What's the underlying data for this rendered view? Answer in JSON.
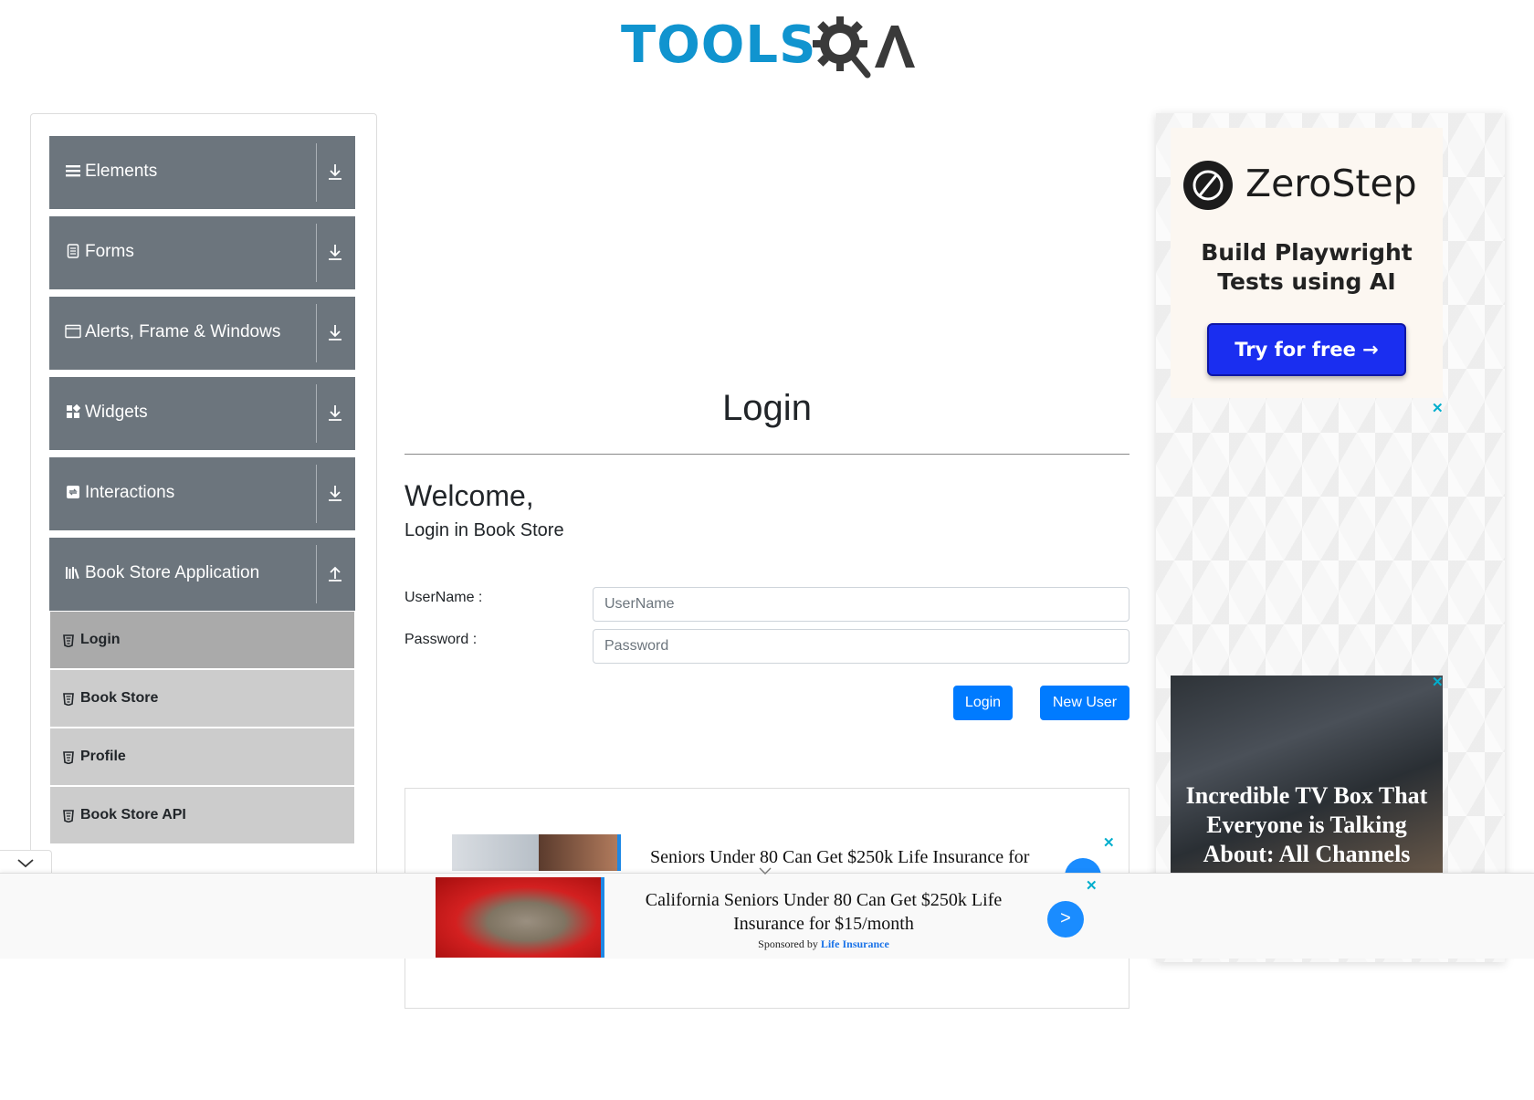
{
  "header": {
    "logo_text_left": "TOOLS",
    "logo_text_right": "QA"
  },
  "sidebar": {
    "groups": [
      {
        "label": "Elements",
        "icon": "list-icon"
      },
      {
        "label": "Forms",
        "icon": "document-icon"
      },
      {
        "label": "Alerts, Frame & Windows",
        "icon": "window-icon"
      },
      {
        "label": "Widgets",
        "icon": "widgets-icon"
      },
      {
        "label": "Interactions",
        "icon": "interactions-icon"
      },
      {
        "label": "Book Store Application",
        "icon": "books-icon",
        "expanded": true
      }
    ],
    "items": [
      {
        "label": "Login",
        "active": true
      },
      {
        "label": "Book Store"
      },
      {
        "label": "Profile"
      },
      {
        "label": "Book Store API"
      }
    ]
  },
  "main": {
    "title": "Login",
    "welcome": "Welcome,",
    "subtitle": "Login in Book Store",
    "username_label": "UserName :",
    "username_placeholder": "UserName",
    "password_label": "Password :",
    "password_placeholder": "Password",
    "login_button": "Login",
    "new_user_button": "New User"
  },
  "inline_ad": {
    "text": "Seniors Under 80 Can Get $250k Life Insurance for",
    "close": "✕"
  },
  "right_ad": {
    "brand": "ZeroStep",
    "tagline": "Build Playwright Tests using AI",
    "cta": "Try for free →",
    "close": "✕",
    "tv_text": "Incredible TV Box That Everyone is Talking About: All Channels",
    "tv_close": "✕"
  },
  "sticky_ad": {
    "title": "California Seniors Under 80 Can Get $250k Life Insurance for $15/month",
    "sponsored_prefix": "Sponsored by",
    "sponsor": "Life Insurance",
    "go": ">",
    "close": "✕"
  },
  "colors": {
    "sidebar_group_bg": "#6c757d",
    "sidebar_item_bg": "#cccccc",
    "sidebar_item_active_bg": "#aaaaaa",
    "primary_button": "#007bff",
    "logo_blue": "#1094cf",
    "logo_dark": "#3a3a3a"
  }
}
